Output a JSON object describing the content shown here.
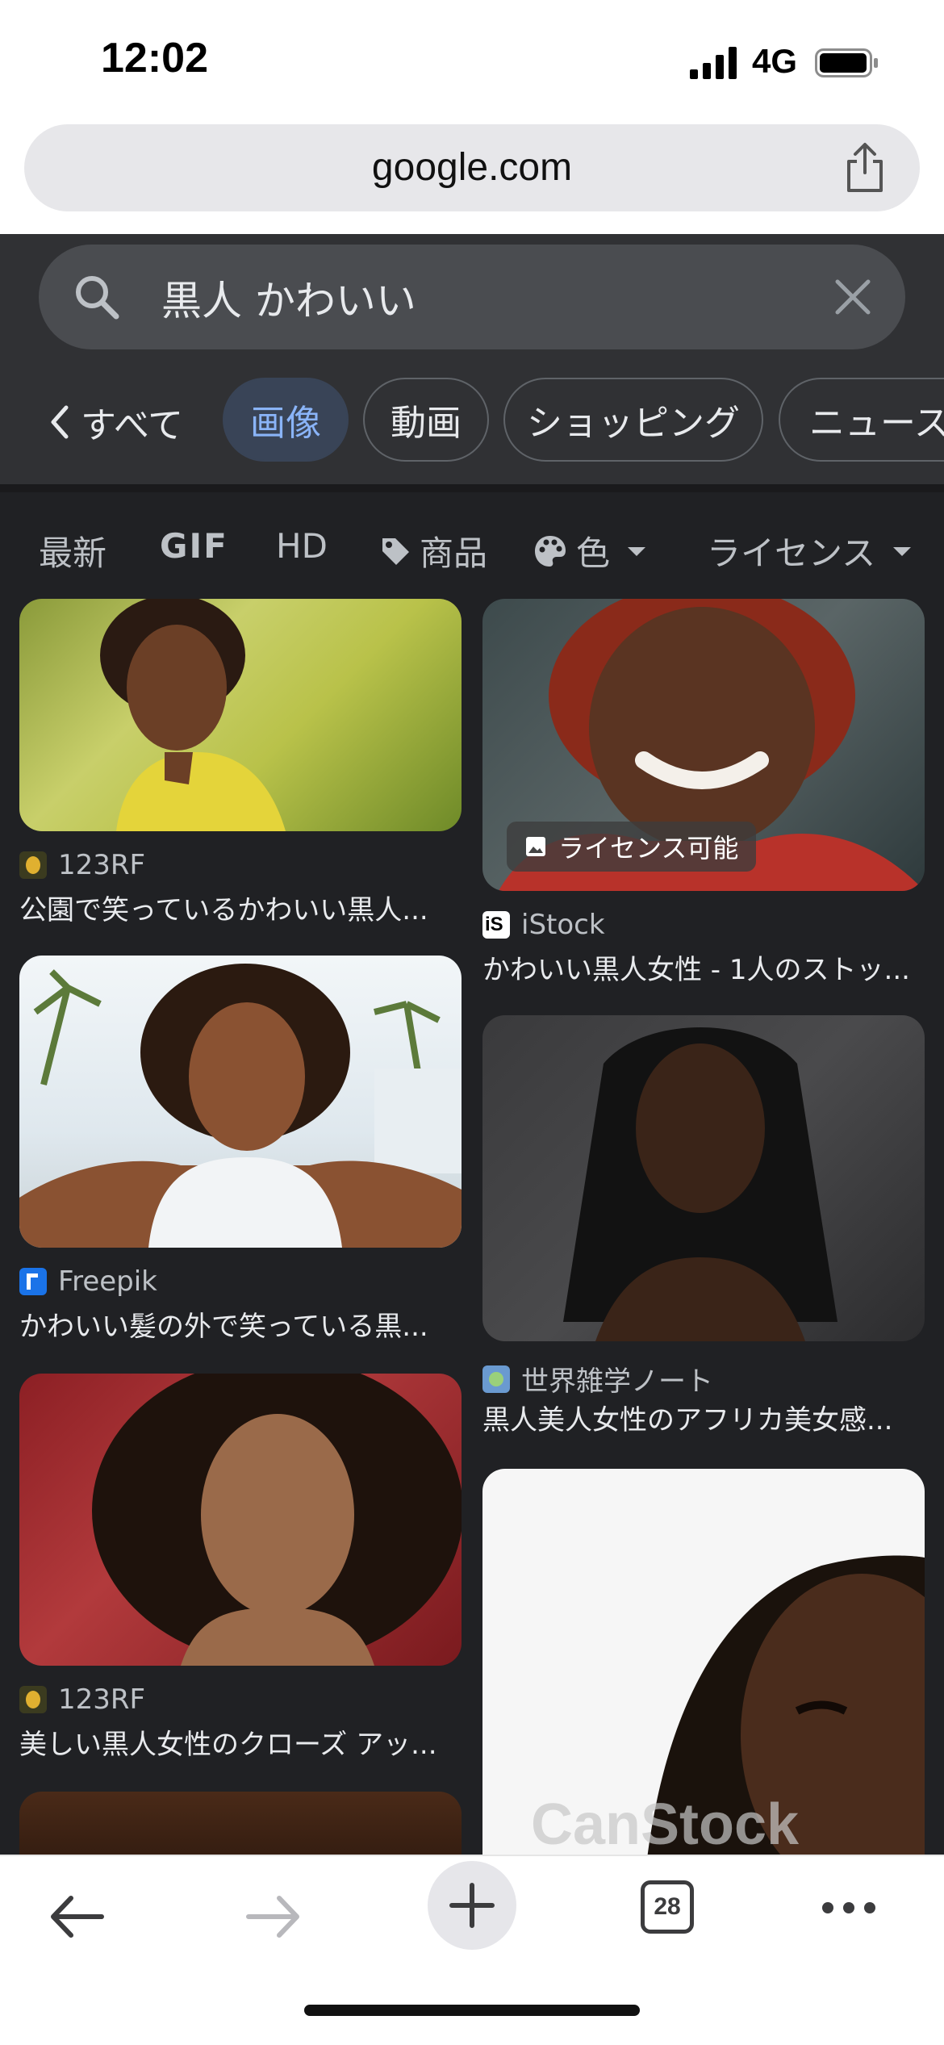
{
  "status": {
    "time": "12:02",
    "network": "4G"
  },
  "browser": {
    "url": "google.com",
    "tab_count": "28"
  },
  "search": {
    "query": "黒人 かわいい"
  },
  "tabs": {
    "back_label": "すべて",
    "items": [
      "画像",
      "動画",
      "ショッピング",
      "ニュース"
    ],
    "active": "画像"
  },
  "filters": {
    "latest": "最新",
    "gif": "GIF",
    "hd": "HD",
    "products": "商品",
    "color": "色",
    "license": "ライセンス"
  },
  "results": [
    {
      "source": "123RF",
      "title": "公園で笑っているかわいい黒人..."
    },
    {
      "source": "iStock",
      "title": "かわいい黒人女性 - 1人のストッ...",
      "badge": "ライセンス可能"
    },
    {
      "source": "Freepik",
      "title": "かわいい髪の外で笑っている黒..."
    },
    {
      "source": "世界雑学ノート",
      "title": "黒人美人女性のアフリカ美女感..."
    },
    {
      "source": "123RF",
      "title": "美しい黒人女性のクローズ アッ..."
    },
    {
      "source": "CanStock",
      "title": ""
    }
  ],
  "colors": {
    "bg": "#202124",
    "header": "#303134",
    "accent": "#8ab4f8",
    "chip_active": "#394457"
  }
}
